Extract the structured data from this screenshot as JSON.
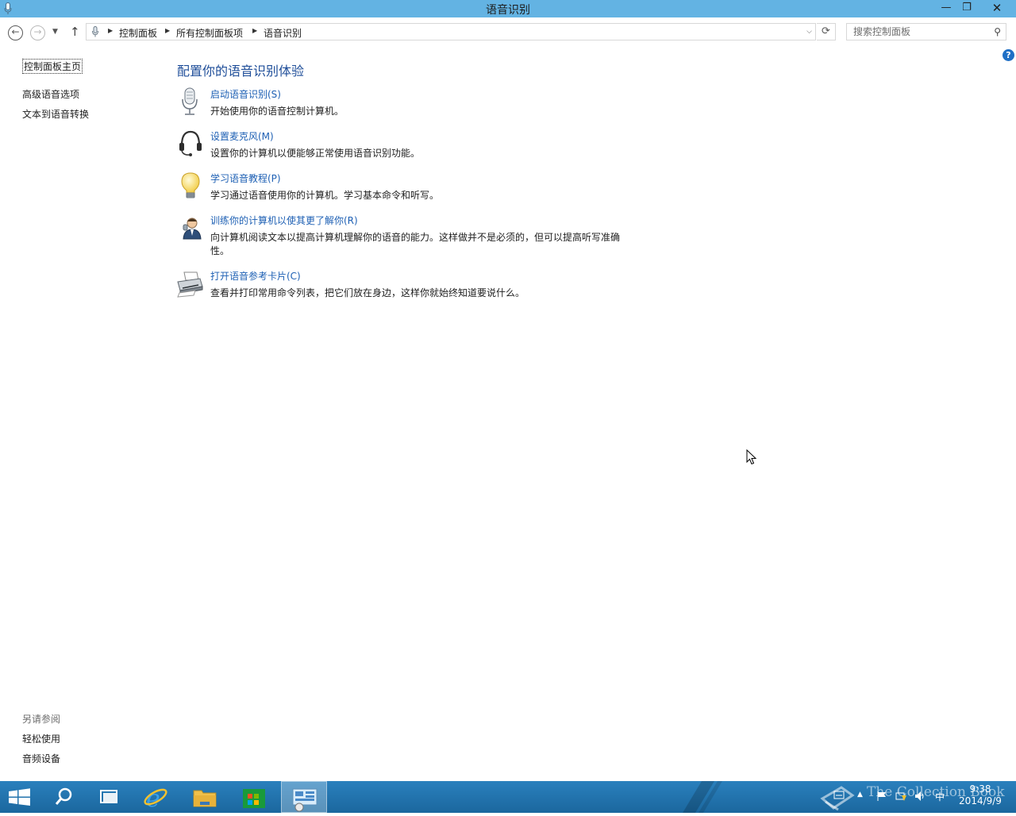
{
  "window": {
    "title": "语音识别",
    "minimize_glyph": "—",
    "maximize_glyph": "❐",
    "close_glyph": "✕"
  },
  "navigation": {
    "breadcrumbs": [
      "控制面板",
      "所有控制面板项",
      "语音识别"
    ],
    "search_placeholder": "搜索控制面板"
  },
  "sidebar": {
    "home_link": "控制面板主页",
    "links": [
      "高级语音选项",
      "文本到语音转换"
    ],
    "see_also_label": "另请参阅",
    "see_also_links": [
      "轻松使用",
      "音频设备"
    ]
  },
  "main": {
    "heading": "配置你的语音识别体验",
    "tasks": [
      {
        "icon": "microphone-icon",
        "link": "启动语音识别(S)",
        "description": "开始使用你的语音控制计算机。"
      },
      {
        "icon": "headset-icon",
        "link": "设置麦克风(M)",
        "description": "设置你的计算机以便能够正常使用语音识别功能。"
      },
      {
        "icon": "lightbulb-icon",
        "link": "学习语音教程(P)",
        "description": "学习通过语音使用你的计算机。学习基本命令和听写。"
      },
      {
        "icon": "user-training-icon",
        "link": "训练你的计算机以使其更了解你(R)",
        "description": "向计算机阅读文本以提高计算机理解你的语音的能力。这样做并不是必须的，但可以提高听写准确性。"
      },
      {
        "icon": "printer-icon",
        "link": "打开语音参考卡片(C)",
        "description": "查看并打印常用命令列表，把它们放在身边，这样你就始终知道要说什么。"
      }
    ]
  },
  "taskbar": {
    "clock_time": "9:38",
    "clock_date": "2014/9/9",
    "watermark": "The Collection Book",
    "ime_label": "中"
  },
  "colors": {
    "titlebar": "#63b3e3",
    "link": "#1e60b4",
    "heading": "#1f4e99",
    "taskbar": "#1e6fa8"
  }
}
